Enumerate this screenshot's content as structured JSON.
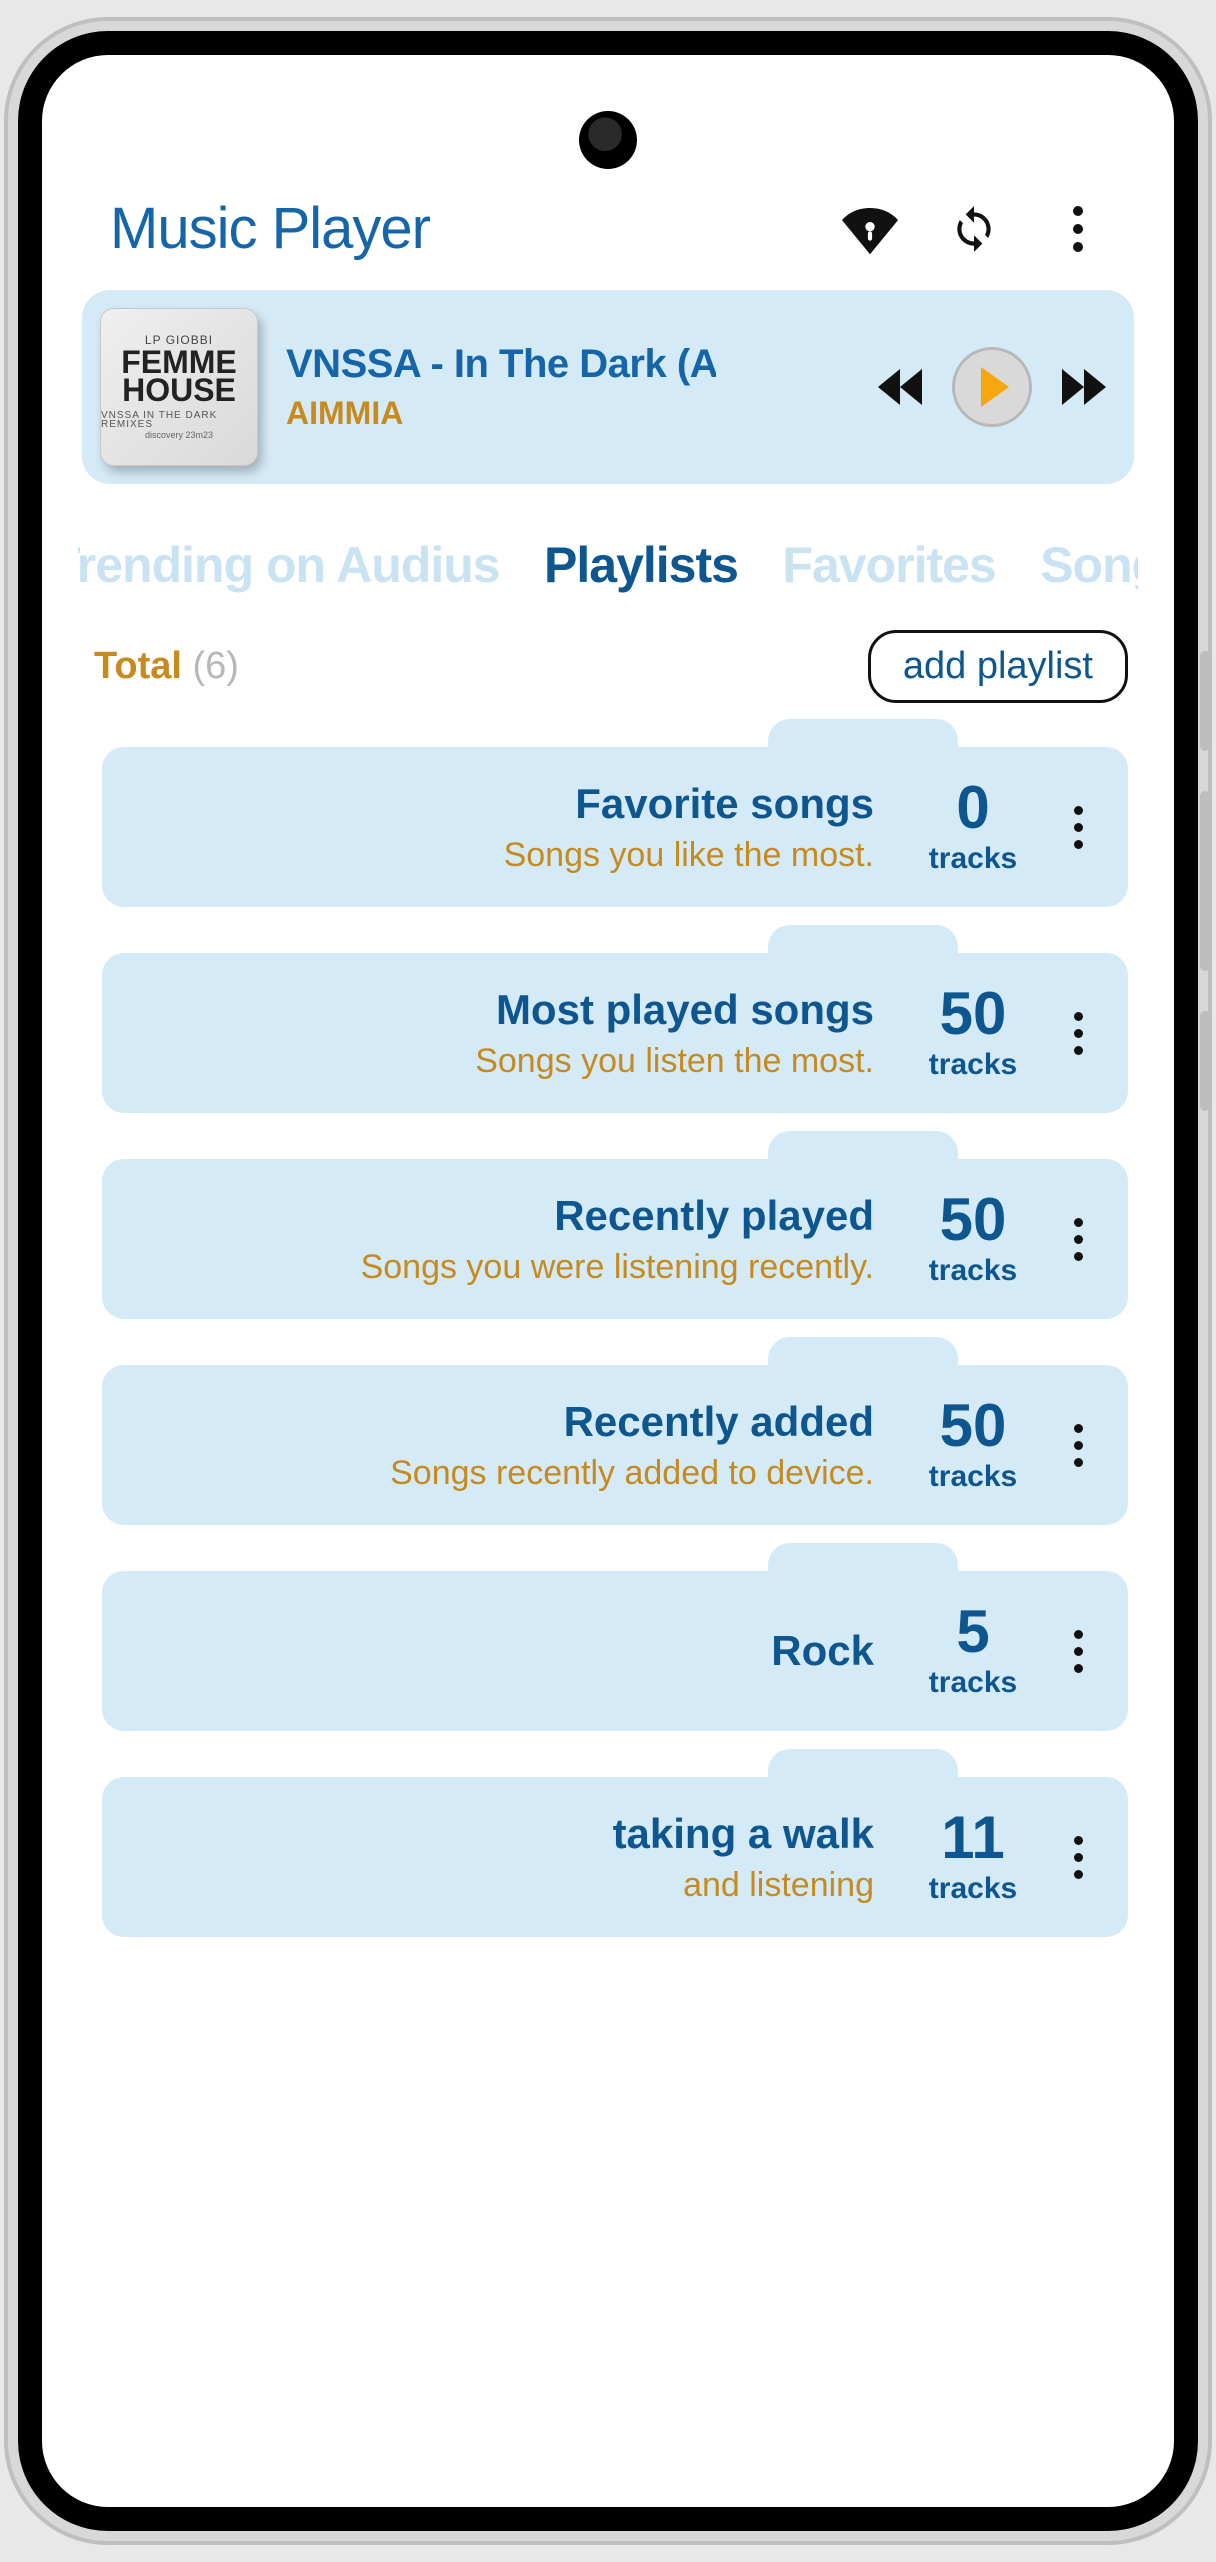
{
  "header": {
    "title": "Music Player"
  },
  "now_playing": {
    "title": "VNSSA - In The Dark (AIMMIA",
    "artist": "AIMMIA",
    "album_art": {
      "line1": "LP GIOBBI",
      "line2": "FEMME",
      "line3": "HOUSE",
      "line4": "VNSSA IN THE DARK REMIXES",
      "line5": "discovery  23m23"
    }
  },
  "tabs": {
    "items": [
      "Trending on Audius",
      "Playlists",
      "Favorites",
      "Songs"
    ],
    "active_index": 1
  },
  "totals": {
    "label": "Total",
    "count_paren": "(6)"
  },
  "add_button": {
    "label": "add playlist"
  },
  "tracks_label": "tracks",
  "playlists": [
    {
      "title": "Favorite songs",
      "subtitle": "Songs you like the most.",
      "count": "0"
    },
    {
      "title": "Most played songs",
      "subtitle": "Songs you listen the most.",
      "count": "50"
    },
    {
      "title": "Recently played",
      "subtitle": "Songs you were listening recently.",
      "count": "50"
    },
    {
      "title": "Recently added",
      "subtitle": "Songs recently added to device.",
      "count": "50"
    },
    {
      "title": "Rock",
      "subtitle": "",
      "count": "5"
    },
    {
      "title": "taking a walk",
      "subtitle": "and listening",
      "count": "11"
    }
  ]
}
